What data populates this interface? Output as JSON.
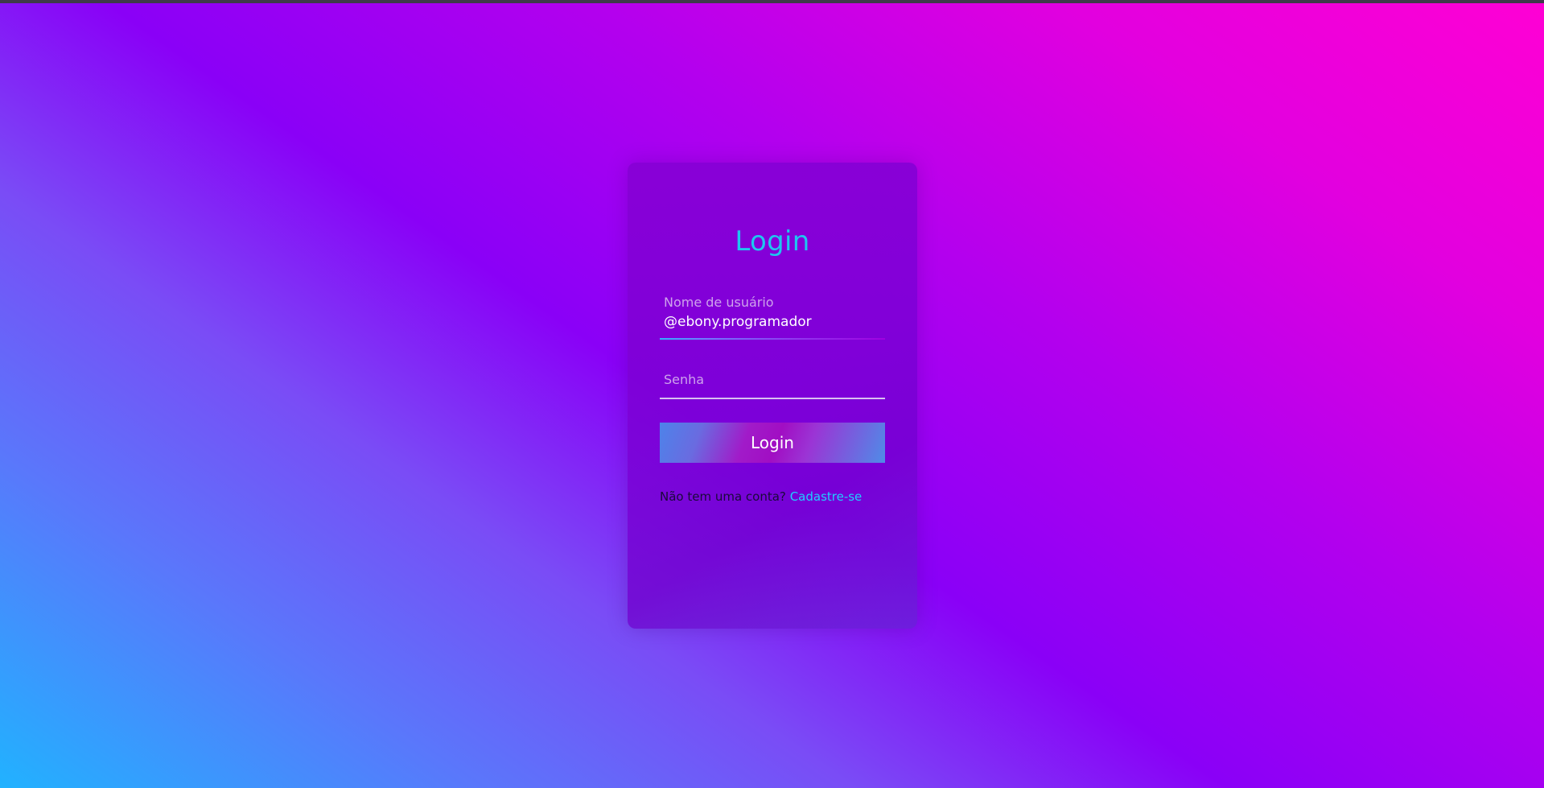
{
  "page": {
    "login_title": "Login"
  },
  "form": {
    "username_label": "Nome de usuário",
    "username_value": "@ebony.programador",
    "password_placeholder": "Senha",
    "login_button": "Login",
    "no_account_text": "Não tem uma conta?",
    "signup_link": "Cadastre-se"
  },
  "colors": {
    "title_accent": "#1ec7f0",
    "link_accent": "#1fd0ff",
    "background_gradient_start": "#21b2ff",
    "background_gradient_mid": "#8a00f7",
    "background_gradient_end": "#ff00d4"
  }
}
